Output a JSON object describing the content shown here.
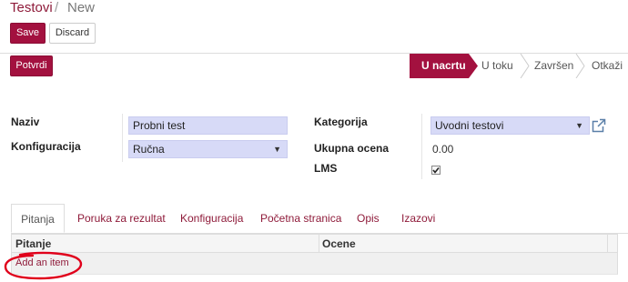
{
  "breadcrumb": {
    "root": "Testovi",
    "separator": "/",
    "current": "New"
  },
  "buttons": {
    "save": "Save",
    "discard": "Discard",
    "confirm": "Potvrdi"
  },
  "statusbar": {
    "stages": [
      "U nacrtu",
      "U toku",
      "Završen",
      "Otkaži"
    ],
    "active_index": 0,
    "active_color": "#a3113f"
  },
  "form": {
    "naziv_label": "Naziv",
    "naziv_value": "Probni test",
    "konfiguracija_label": "Konfiguracija",
    "konfiguracija_value": "Ručna",
    "kategorija_label": "Kategorija",
    "kategorija_value": "Uvodni testovi",
    "ukupna_ocena_label": "Ukupna ocena",
    "ukupna_ocena_value": "0.00",
    "lms_label": "LMS",
    "lms_checked": true
  },
  "tabs": [
    "Pitanja",
    "Poruka za rezultat",
    "Konfiguracija",
    "Početna stranica",
    "Opis",
    "Izazovi"
  ],
  "table": {
    "columns": [
      "Pitanje",
      "Ocene"
    ],
    "add_item": "Add an item"
  },
  "colors": {
    "brand": "#a3113f",
    "input_bg": "#d7daf7",
    "annotation": "#e0001b"
  }
}
